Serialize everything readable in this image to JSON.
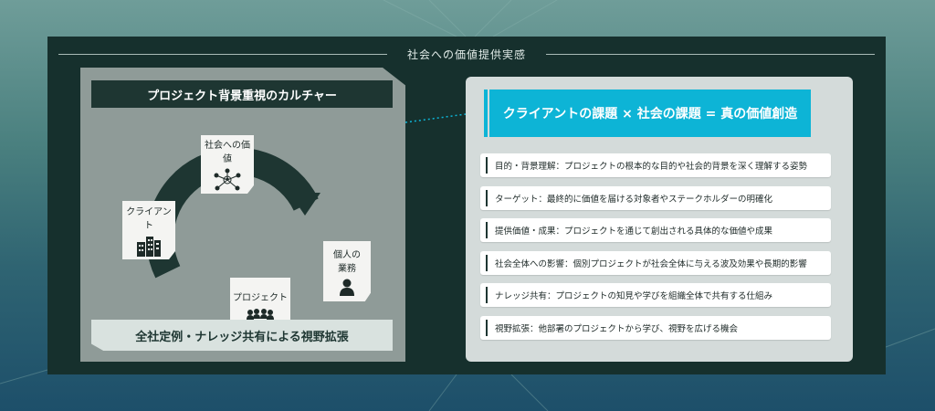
{
  "frame": {
    "title": "社会への価値提供実感"
  },
  "left": {
    "header": "プロジェクト背景重視のカルチャー",
    "footer": "全社定例・ナレッジ共有による視野拡張",
    "cards": {
      "society": "社会への価値",
      "client": "クライアント",
      "individual_line1": "個人の",
      "individual_line2": "業務",
      "project": "プロジェクト"
    },
    "icons": {
      "society": "network-people-icon",
      "client": "office-building-icon",
      "individual": "person-icon",
      "project": "team-meeting-icon"
    }
  },
  "right": {
    "header": "クライアントの課題 × 社会の課題 = 真の価値創造",
    "items": [
      "目的・背景理解：プロジェクトの根本的な目的や社会的背景を深く理解する姿勢",
      "ターゲット：最終的に価値を届ける対象者やステークホルダーの明確化",
      "提供価値・成果：プロジェクトを通じて創出される具体的な価値や成果",
      "社会全体への影響：個別プロジェクトが社会全体に与える波及効果や長期的影響",
      "ナレッジ共有：プロジェクトの知見や学びを組織全体で共有する仕組み",
      "視野拡張：他部署のプロジェクトから学び、視野を広げる機会"
    ]
  },
  "colors": {
    "frame": "#16302d",
    "accent": "#0db4d6",
    "dark_band": "#1e3632",
    "cycle_arrow": "#1e3632"
  }
}
